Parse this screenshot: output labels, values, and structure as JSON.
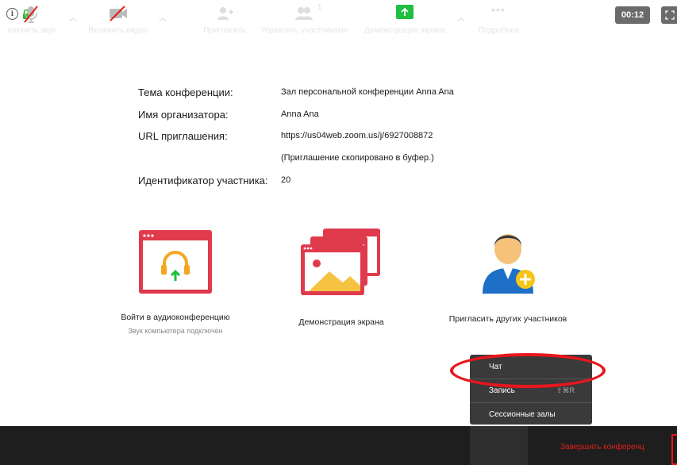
{
  "header": {
    "timer": "00:12"
  },
  "info": {
    "topic_label": "Тема конференции:",
    "topic_value": "Зал персональной конференции Anna Ana",
    "host_label": "Имя организатора:",
    "host_value": "Anna Ana",
    "url_label": "URL приглашения:",
    "url_value": "https://us04web.zoom.us/j/6927008872",
    "url_note": "(Приглашение скопировано в буфер.)",
    "participant_label": "Идентификатор участника:",
    "participant_value": "20"
  },
  "tiles": {
    "audio_label": "Войти в аудиоконференцию",
    "audio_sub": "Звук компьютера подключен",
    "share_label": "Демонстрация экрана",
    "invite_label": "Пригласить других участников"
  },
  "more_menu": {
    "chat": "Чат",
    "record": "Запись",
    "record_shortcut": "⇧⌘R",
    "breakout": "Сессионные залы"
  },
  "toolbar": {
    "mute": "ключить звук",
    "video": "Включить видео",
    "invite": "Пригласить",
    "participants": "Управлять участниками",
    "participants_count": "1",
    "share": "Демонстрация экрана",
    "more": "Подробнее",
    "end": "Завершить конференц"
  },
  "colors": {
    "accent_red": "#e8161c",
    "tile_red": "#e03a4d",
    "share_green": "#1fbf3f",
    "toolbar_bg": "#1e1e1e"
  }
}
